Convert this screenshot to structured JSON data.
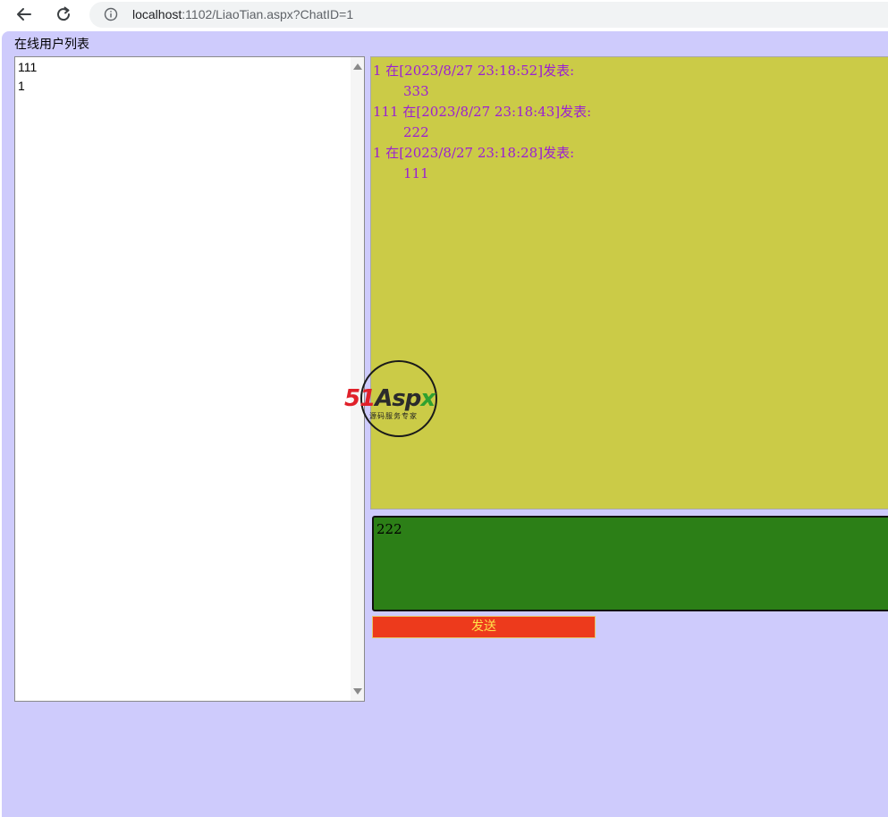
{
  "browser": {
    "url_host": "localhost",
    "url_rest": ":1102/LiaoTian.aspx?ChatID=1"
  },
  "users": {
    "title": "在线用户列表",
    "items": [
      "111",
      "1"
    ]
  },
  "messages": [
    {
      "header": "1 在[2023/8/27 23:18:52]发表:",
      "body": "333"
    },
    {
      "header": "111 在[2023/8/27 23:18:43]发表:",
      "body": "222"
    },
    {
      "header": "1 在[2023/8/27 23:18:28]发表:",
      "body": "111"
    }
  ],
  "compose": {
    "value": "222"
  },
  "send_label": "发送",
  "watermark": {
    "brand_num": "51",
    "brand_a": "Asp",
    "brand_x": "x",
    "sub": "源码服务专家"
  },
  "colors": {
    "page_bg": "#cecbfc",
    "messages_bg": "#cbcb47",
    "message_text": "#9b1fd3",
    "compose_bg": "#2c7f17",
    "send_bg": "#ed3a1c",
    "send_text": "#ffe24a"
  },
  "icons": {
    "back": "arrow-left-icon",
    "reload": "reload-icon",
    "info": "info-icon"
  }
}
